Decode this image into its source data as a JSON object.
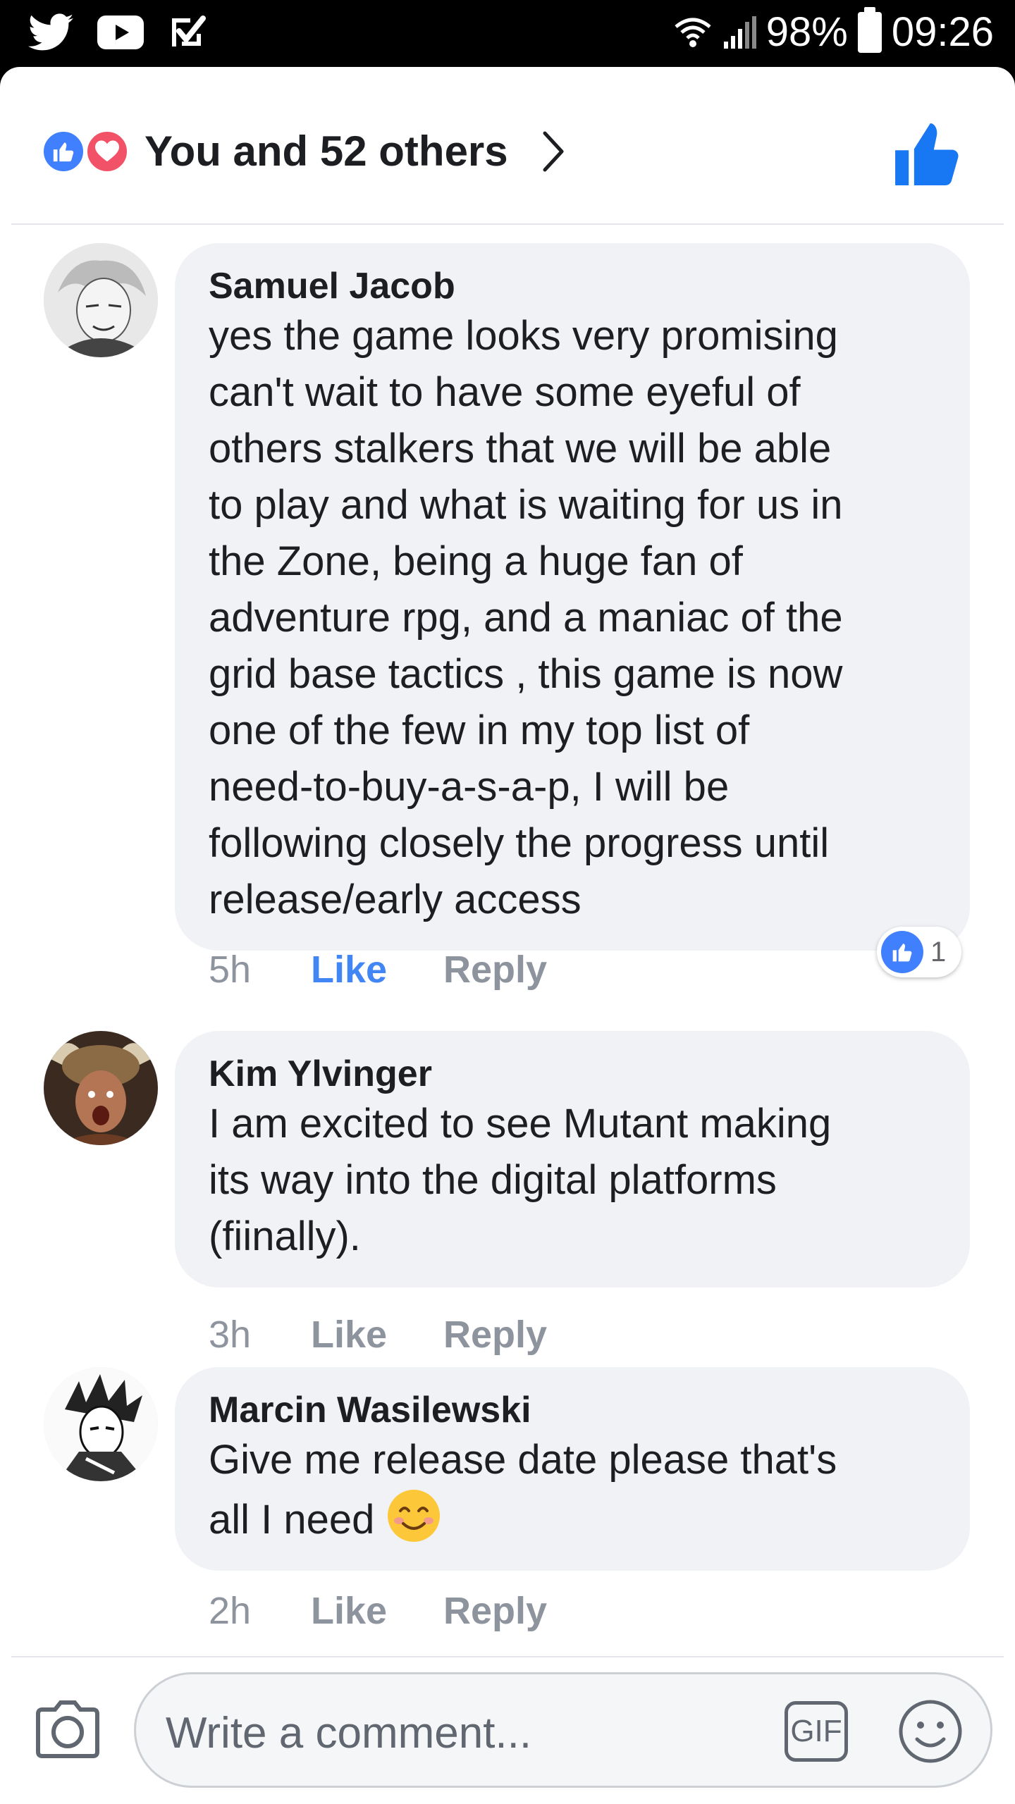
{
  "status_bar": {
    "battery_percent": "98%",
    "time": "09:26",
    "left_icons": [
      "twitter-icon",
      "youtube-icon",
      "checkmark-app-icon"
    ],
    "right_icons": [
      "wifi-icon",
      "signal-icon",
      "battery-icon"
    ]
  },
  "reactions": {
    "summary": "You and 52 others",
    "types": [
      "like",
      "love"
    ]
  },
  "comments": [
    {
      "author": "Samuel Jacob",
      "lines": [
        "yes the game looks very promising",
        "can't wait to have some eyeful of",
        "others stalkers that we will be able",
        "to play and what is waiting for us in",
        "the Zone, being a huge fan of",
        "adventure rpg, and a maniac of the",
        "grid base tactics , this game is now",
        "one of the few in my top list of",
        "need-to-buy-a-s-a-p, I will be",
        "following closely the progress until",
        "release/early access"
      ],
      "time": "5h",
      "like_label": "Like",
      "like_active": true,
      "reply_label": "Reply",
      "reaction_count": "1"
    },
    {
      "author": "Kim Ylvinger",
      "lines": [
        "I am excited to see Mutant making",
        "its way into the digital platforms",
        "(fiinally)."
      ],
      "time": "3h",
      "like_label": "Like",
      "like_active": false,
      "reply_label": "Reply"
    },
    {
      "author": "Marcin Wasilewski",
      "lines": [
        "Give me release date please that's",
        "all I need"
      ],
      "emoji": "smiling-face-emoji",
      "time": "2h",
      "like_label": "Like",
      "like_active": false,
      "reply_label": "Reply"
    }
  ],
  "composer": {
    "placeholder": "Write a comment...",
    "gif_label": "GIF"
  },
  "colors": {
    "accent_blue": "#4080ff",
    "love_red": "#f25268",
    "bubble_bg": "#f0f2f5",
    "muted_text": "#8d949e"
  }
}
